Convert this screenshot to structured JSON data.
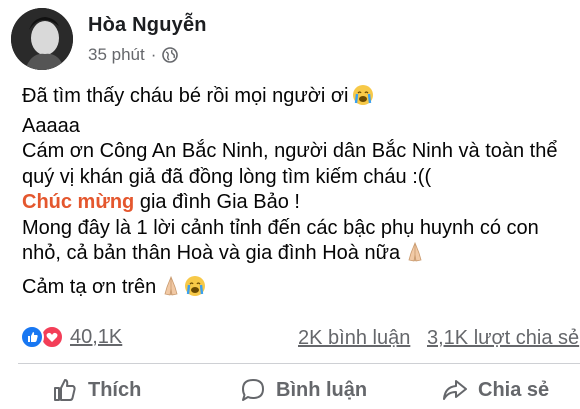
{
  "post": {
    "author": "Hòa Nguyễn",
    "time": "35 phút",
    "separator": "·",
    "lines": [
      {
        "text": "Đã tìm thấy cháu bé rồi mọi người ơi",
        "emoji": "crying-face-icon"
      },
      {
        "text": "Aaaaa"
      },
      {
        "text": "Cám ơn Công An Bắc Ninh, người dân Bắc Ninh và toàn thể"
      },
      {
        "text": "quý vị khán giả đã đồng lòng tìm kiếm cháu :(("
      }
    ],
    "congrats_highlight": "Chúc mừng",
    "congrats_rest": " gia đình Gia Bảo !",
    "line_hope_1": "Mong đây là 1 lời cảnh tỉnh đến các bậc phụ huynh có con",
    "line_hope_2": "nhỏ, cả bản thân Hoà và gia đình Hoà nữa",
    "thanks": "Cảm tạ ơn trên"
  },
  "stats": {
    "reactions_count": "40,1K",
    "comments": "2K bình luận",
    "shares": "3,1K lượt chia sẻ"
  },
  "actions": {
    "like": "Thích",
    "comment": "Bình luận",
    "share": "Chia sẻ"
  },
  "colors": {
    "highlight": "#e4572e",
    "like_blue": "#1877f2",
    "love_red": "#f33e58",
    "muted": "#65676b"
  }
}
